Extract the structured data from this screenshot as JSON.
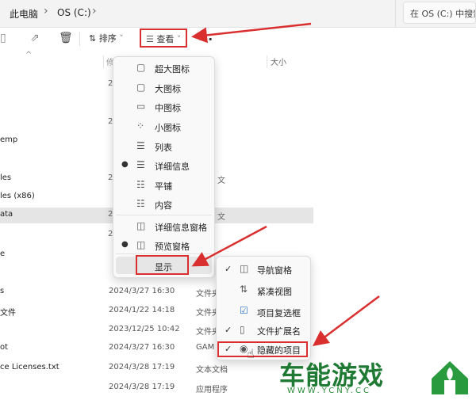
{
  "address_bar": {
    "crumbs": [
      "此电脑",
      "OS (C:)"
    ],
    "search_placeholder": "在 OS (C:) 中搜索"
  },
  "toolbar": {
    "sort_label": "排序",
    "view_label": "查看",
    "more_label": "..."
  },
  "columns": {
    "size": "大小"
  },
  "file_list": [
    {
      "name": "emp",
      "date": "",
      "type": ""
    },
    {
      "name": "les",
      "date": "",
      "type": ""
    },
    {
      "name": "les (x86)",
      "date": "",
      "type": ""
    },
    {
      "name": "ata",
      "date": "",
      "type": ""
    },
    {
      "name": "e",
      "date": "",
      "type": ""
    },
    {
      "name": "s",
      "date": "2024/3/27 16:30",
      "type": "文件夹"
    },
    {
      "name": "文件",
      "date": "2024/1/22 14:18",
      "type": "文件夹"
    },
    {
      "name": "",
      "date": "2023/12/25 10:42",
      "type": "文件夹"
    },
    {
      "name": "ot",
      "date": "2024/3/27 16:30",
      "type": "GAM"
    },
    {
      "name": "ce Licenses.txt",
      "date": "2024/3/28 17:19",
      "type": "文本文档"
    },
    {
      "name": "",
      "date": "2024/3/28 17:19",
      "type": "应用程序"
    }
  ],
  "view_menu": {
    "items": [
      {
        "label": "超大图标",
        "icon": "extra-large-icons-icon",
        "glyph": "▢",
        "selected": false
      },
      {
        "label": "大图标",
        "icon": "large-icons-icon",
        "glyph": "▢",
        "selected": false
      },
      {
        "label": "中图标",
        "icon": "medium-icons-icon",
        "glyph": "▭",
        "selected": false
      },
      {
        "label": "小图标",
        "icon": "small-icons-icon",
        "glyph": "⁘",
        "selected": false
      },
      {
        "label": "列表",
        "icon": "list-icon",
        "glyph": "☰",
        "selected": false
      },
      {
        "label": "详细信息",
        "icon": "details-icon",
        "glyph": "☰",
        "selected": true
      },
      {
        "label": "平铺",
        "icon": "tiles-icon",
        "glyph": "☷",
        "selected": false
      },
      {
        "label": "内容",
        "icon": "content-icon",
        "glyph": "☷",
        "selected": false
      },
      {
        "label": "详细信息窗格",
        "icon": "details-pane-icon",
        "glyph": "◫",
        "selected": false
      },
      {
        "label": "预览窗格",
        "icon": "preview-pane-icon",
        "glyph": "◫",
        "selected": true
      }
    ],
    "show_label": "显示"
  },
  "show_menu": {
    "items": [
      {
        "label": "导航窗格",
        "icon": "navigation-pane-icon",
        "glyph": "◫",
        "checked": true
      },
      {
        "label": "紧凑视图",
        "icon": "compact-view-icon",
        "glyph": "⇅",
        "checked": false
      },
      {
        "label": "项目复选框",
        "icon": "item-checkbox-icon",
        "glyph": "☑",
        "checked": false
      },
      {
        "label": "文件扩展名",
        "icon": "file-extension-icon",
        "glyph": "▯",
        "checked": true
      },
      {
        "label": "隐藏的项目",
        "icon": "hidden-items-icon",
        "glyph": "◉",
        "checked": true
      }
    ]
  },
  "watermark": {
    "brand": "车能游戏",
    "url": "WWW.YCNY.CC"
  },
  "colors": {
    "highlight_red": "#d9302f",
    "watermark_green": "#1f7a34"
  }
}
